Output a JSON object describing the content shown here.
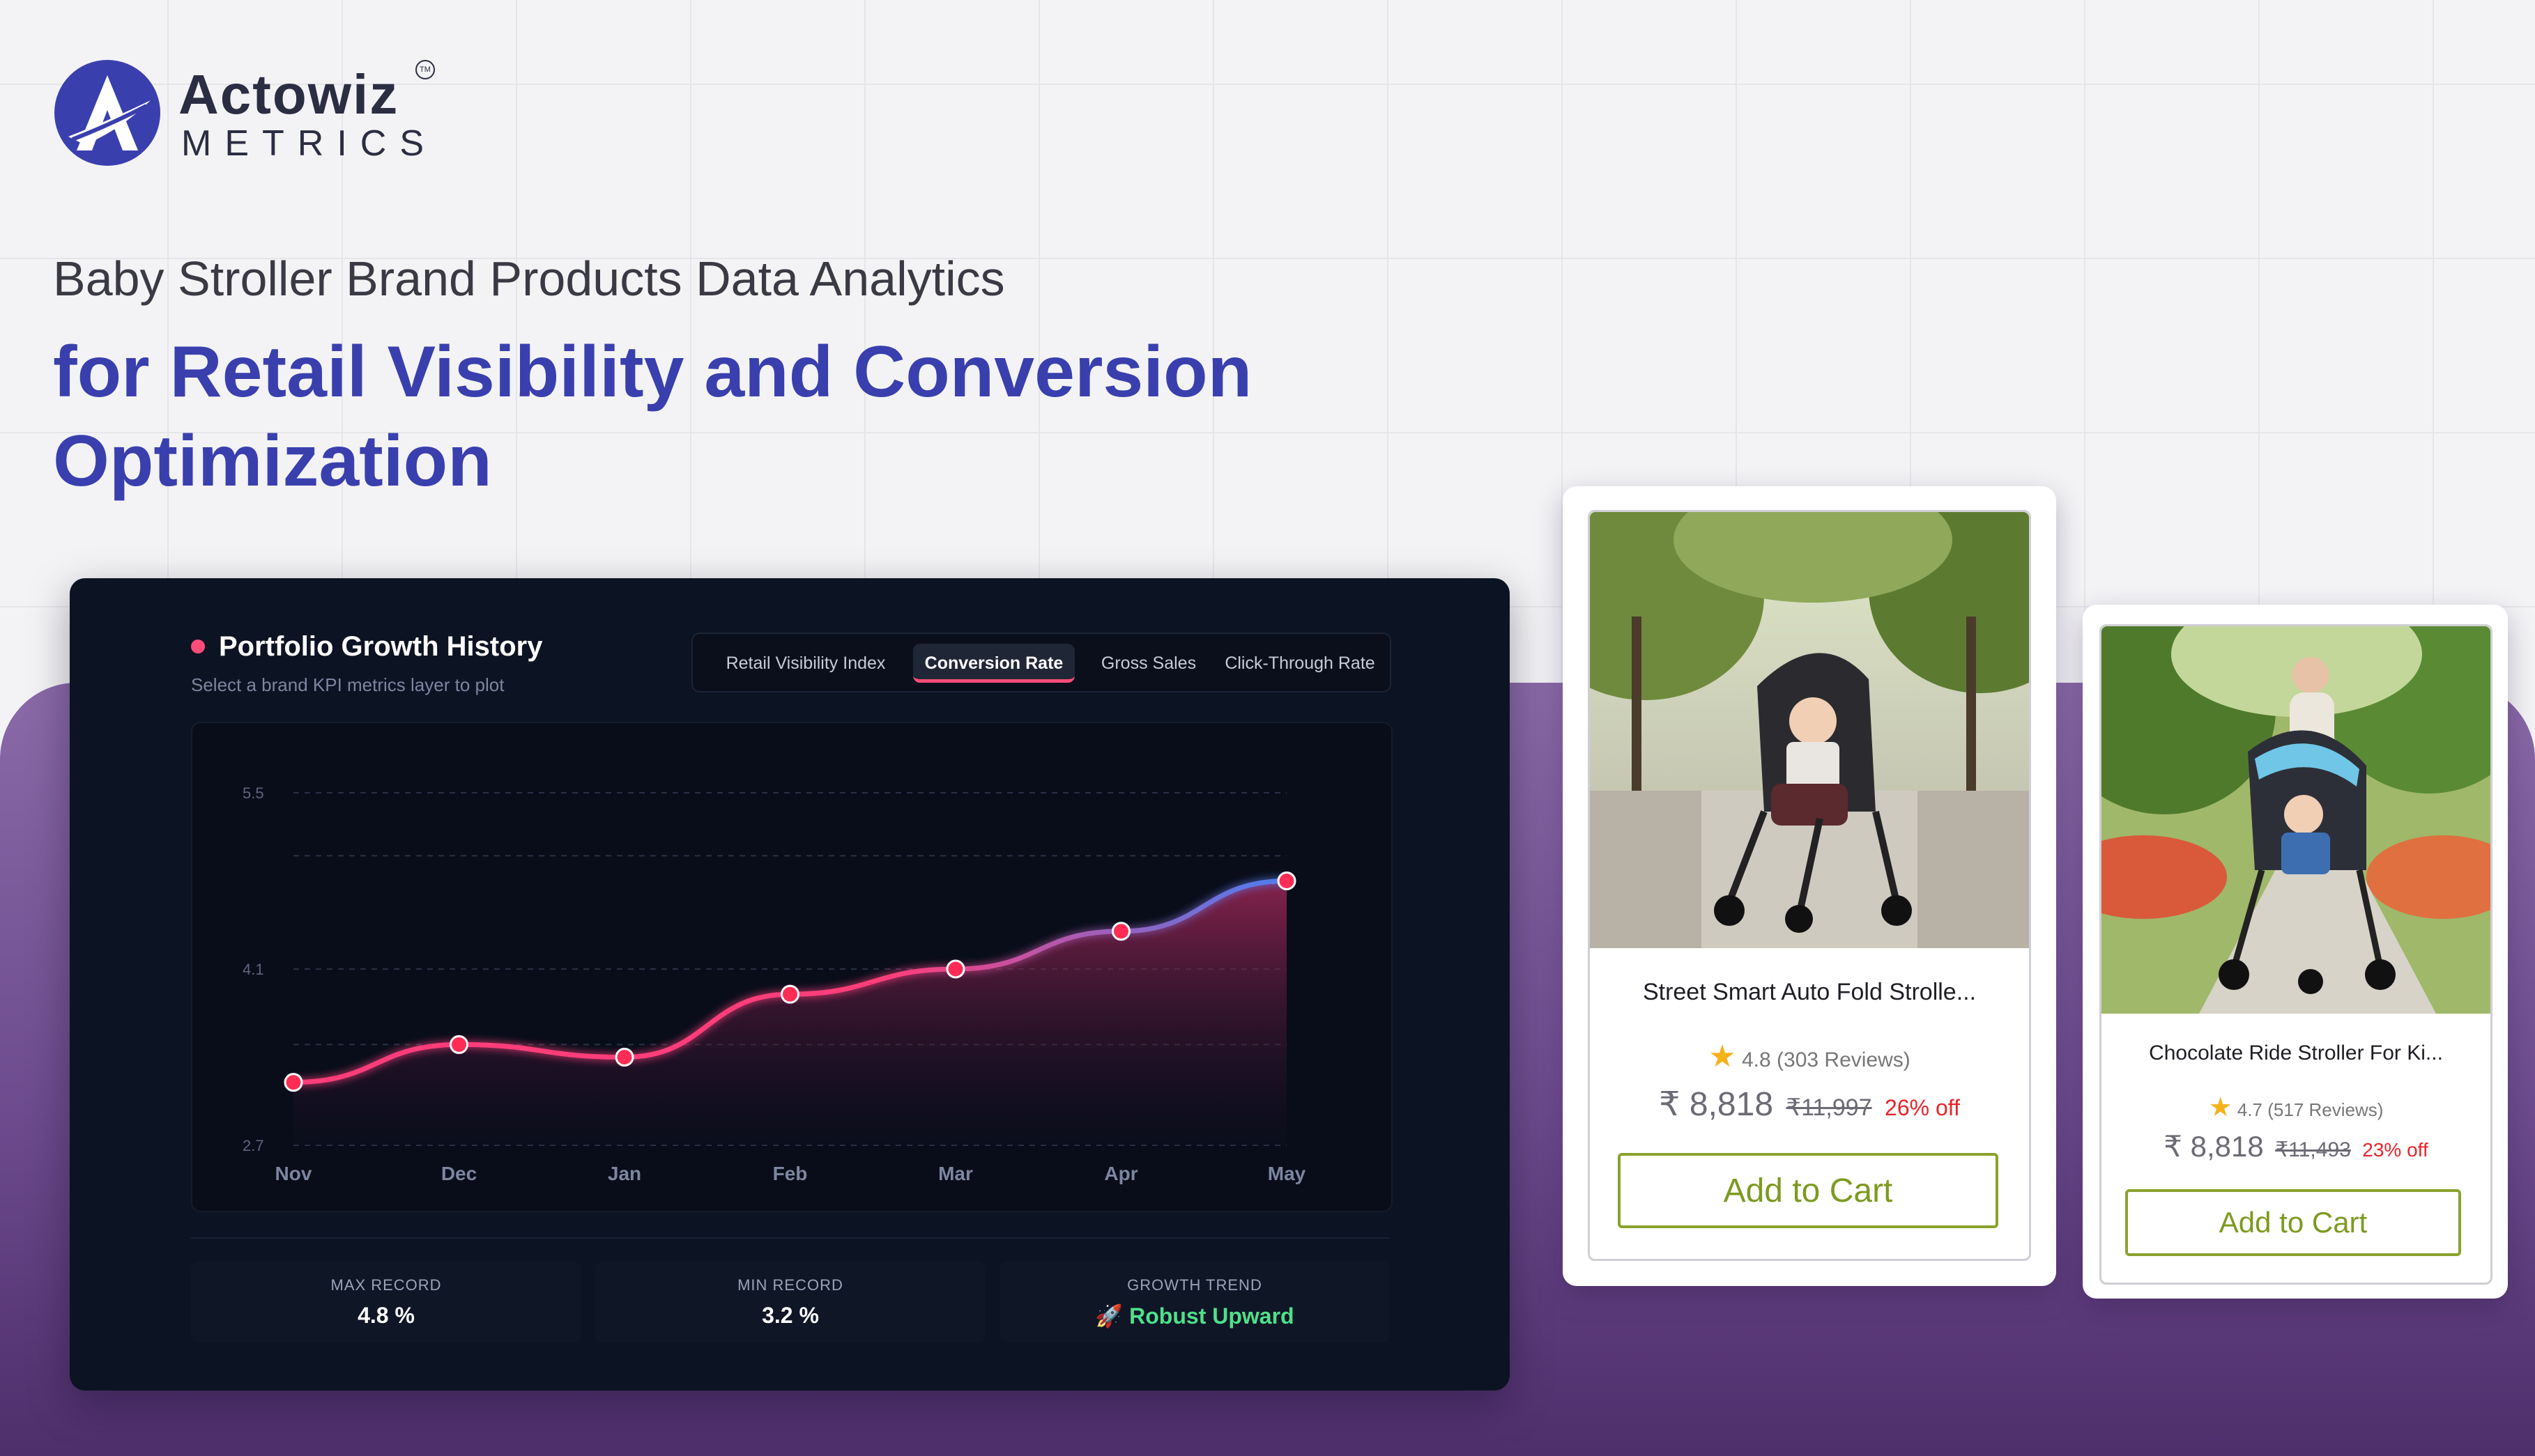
{
  "brand": {
    "name": "Actowiz",
    "sub": "METRICS",
    "tm": "TM"
  },
  "hero": {
    "line1": "Baby Stroller Brand Products Data Analytics",
    "line2": "for Retail Visibility and Conversion Optimization"
  },
  "dashboard": {
    "title": "Portfolio Growth History",
    "subtitle": "Select a brand KPI metrics layer to plot",
    "tabs": [
      {
        "label": "Retail Visibility Index"
      },
      {
        "label": "Conversion Rate",
        "active": true
      },
      {
        "label": "Gross Sales"
      },
      {
        "label": "Click-Through Rate"
      }
    ],
    "stats": [
      {
        "label": "MAX RECORD",
        "value": "4.8 %"
      },
      {
        "label": "MIN RECORD",
        "value": "3.2 %"
      },
      {
        "label": "GROWTH TREND",
        "value": "Robust Upward",
        "icon": "rocket-icon"
      }
    ]
  },
  "chart_data": {
    "type": "area",
    "categories": [
      "Nov",
      "Dec",
      "Jan",
      "Feb",
      "Mar",
      "Apr",
      "May"
    ],
    "values": [
      3.2,
      3.5,
      3.4,
      3.9,
      4.1,
      4.4,
      4.8
    ],
    "yticks": [
      "5.5",
      "4.1",
      "2.7"
    ],
    "ylim": [
      2.7,
      5.5
    ],
    "grid": true,
    "colors": {
      "start": "#ff3d7a",
      "end": "#4d7df0",
      "point": "#ff2d55"
    }
  },
  "products": [
    {
      "title": "Street Smart Auto Fold Strolle...",
      "rating": "4.8 (303 Reviews)",
      "price": "₹ 8,818",
      "mrp": "₹11,997",
      "off": "26% off",
      "button": "Add to Cart"
    },
    {
      "title": "Chocolate Ride Stroller For Ki...",
      "rating": "4.7 (517 Reviews)",
      "price": "₹ 8,818",
      "mrp": "₹11,493",
      "off": "23% off",
      "button": "Add to Cart"
    }
  ],
  "colors": {
    "accent": "#3a3fae",
    "panel": "#0c1322",
    "cart_green": "#7d9a20",
    "discount_red": "#e8232a",
    "band_purple": "#6d4b8e"
  }
}
